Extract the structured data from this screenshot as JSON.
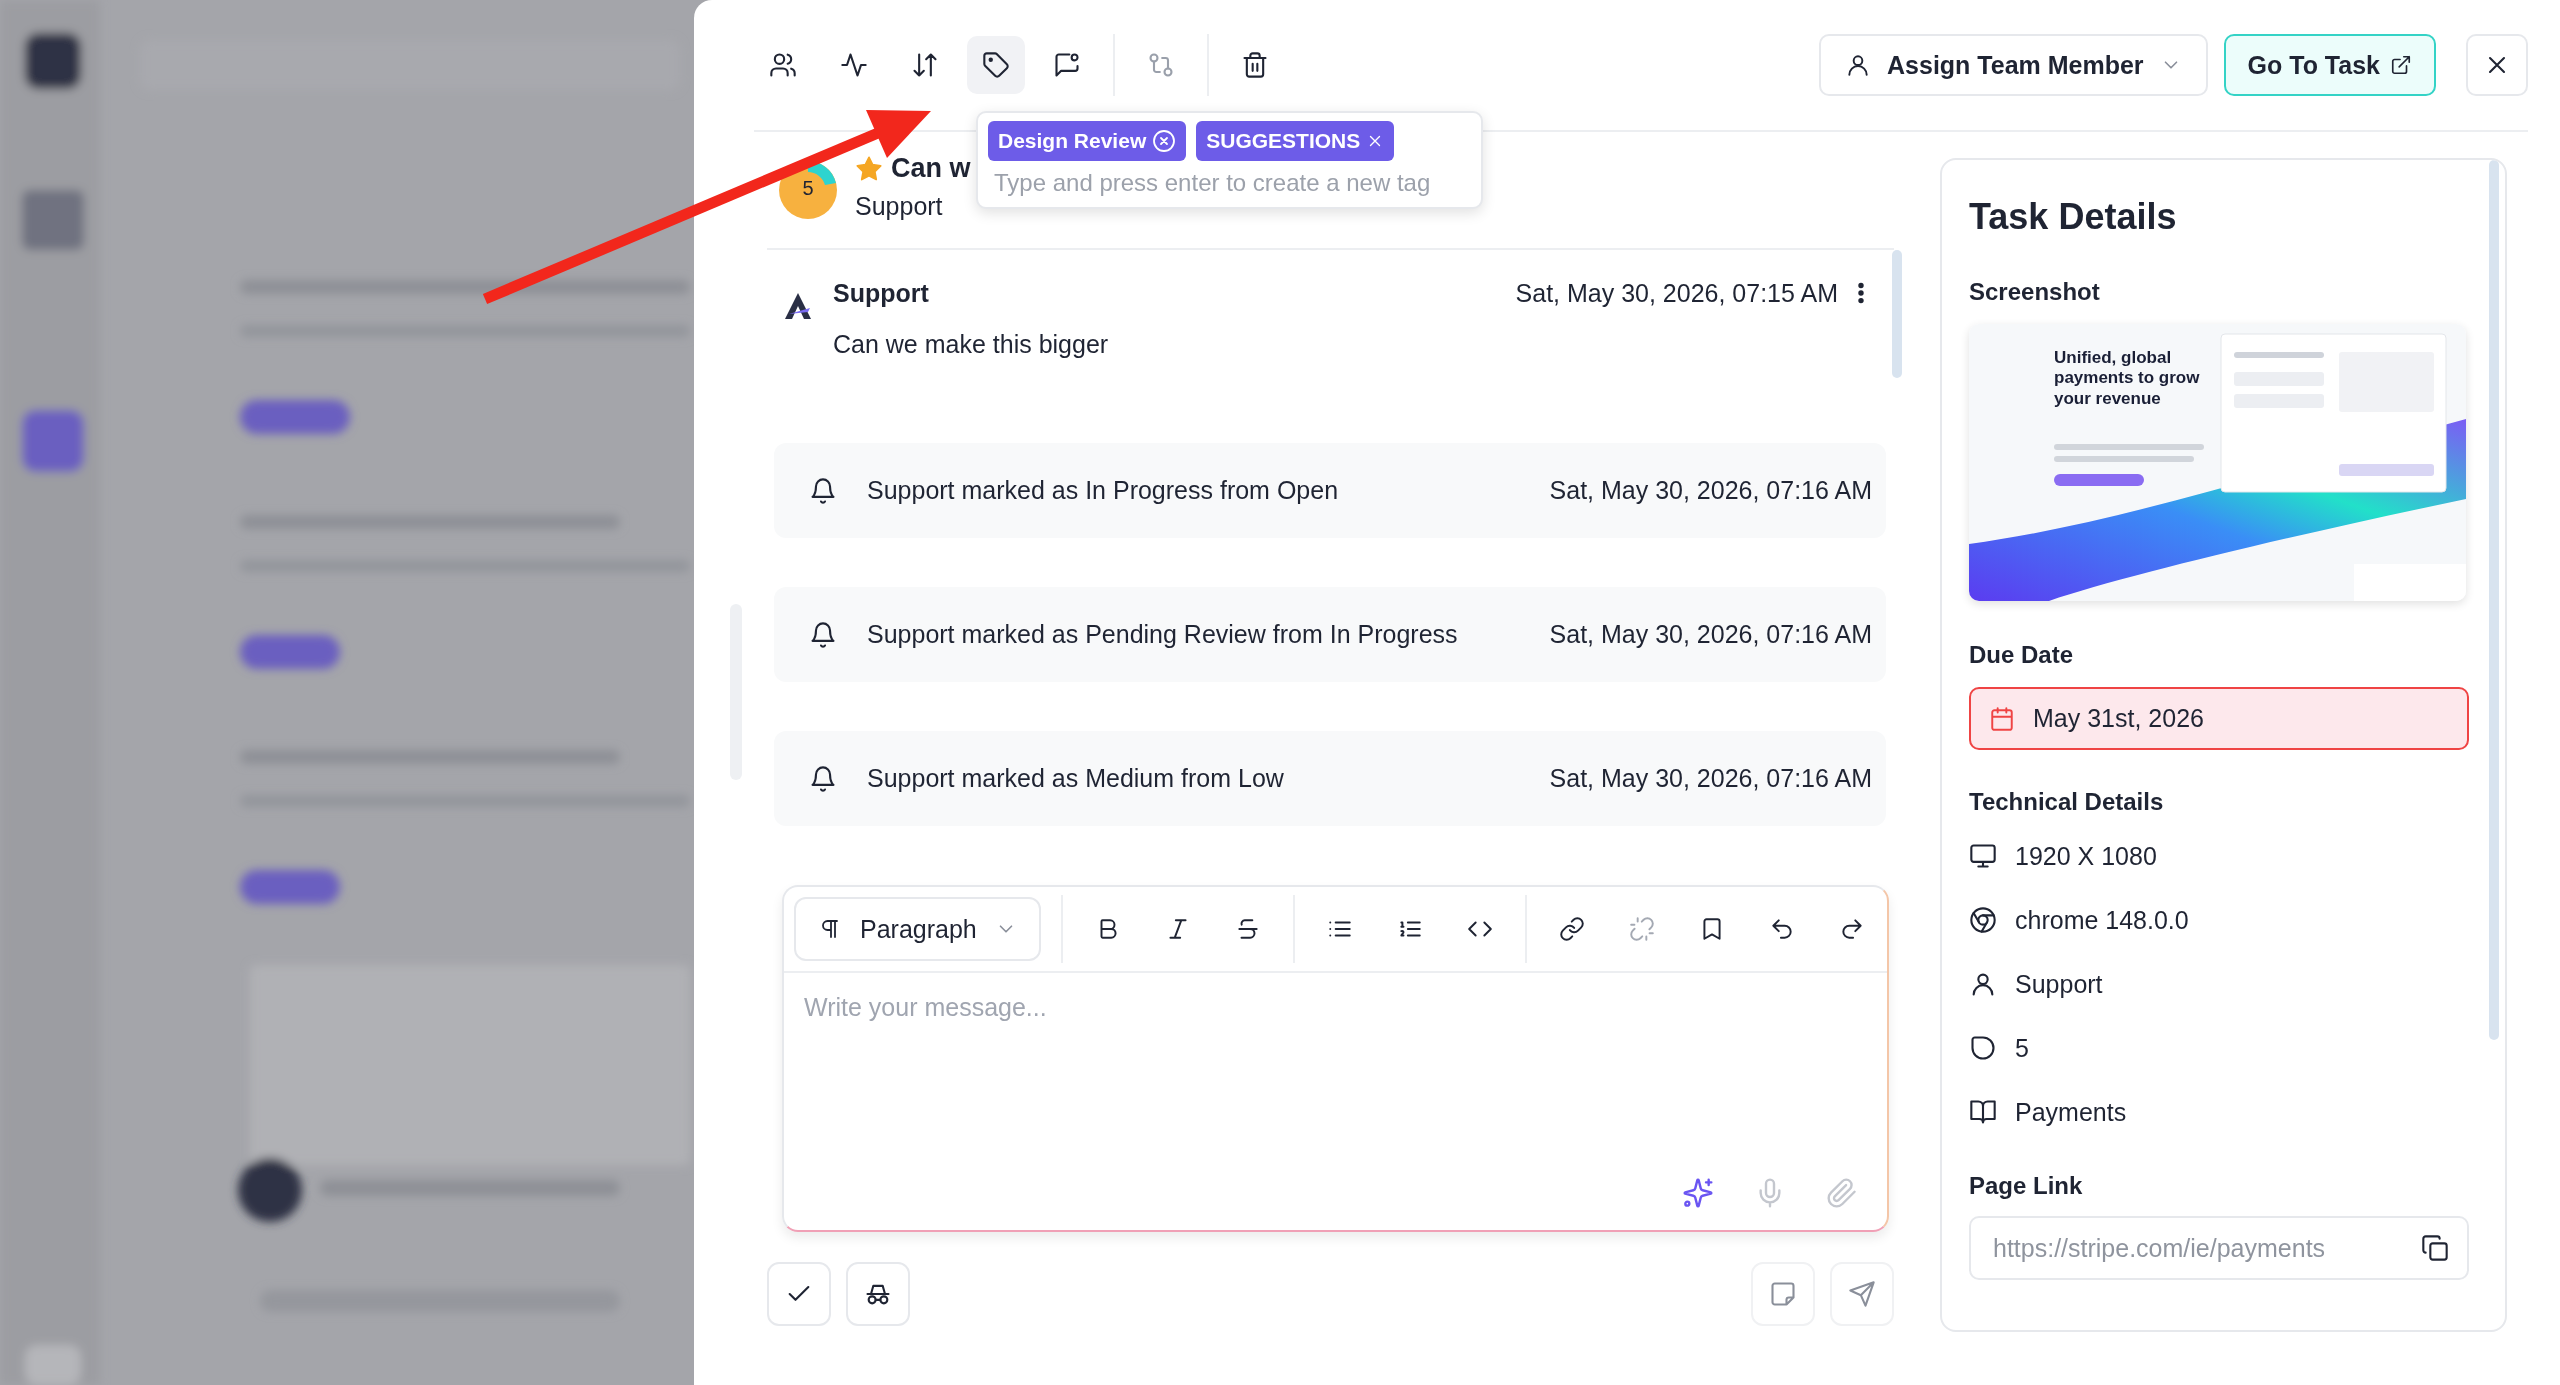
{
  "toolbar": {
    "tool_groups": [
      [
        {
          "kind": "users",
          "selected": false,
          "disabled": false
        },
        {
          "kind": "activity",
          "selected": false,
          "disabled": false
        },
        {
          "kind": "sort",
          "selected": false,
          "disabled": false
        },
        {
          "kind": "tag",
          "selected": true,
          "disabled": false
        },
        {
          "kind": "comment",
          "selected": false,
          "disabled": false
        }
      ],
      [
        {
          "kind": "compare",
          "selected": false,
          "disabled": true
        }
      ],
      [
        {
          "kind": "trash",
          "selected": false,
          "disabled": false
        }
      ]
    ],
    "assign_button": "Assign Team Member",
    "go_to_task_button": "Go To Task"
  },
  "tag_popover": {
    "tags": [
      {
        "label": "Design Review",
        "kind": "circled"
      },
      {
        "label": "SUGGESTIONS",
        "kind": "plain"
      }
    ],
    "placeholder": "Type and press enter to create a new tag"
  },
  "task": {
    "priority": "5",
    "starred": true,
    "title": "Can w",
    "author": "Support"
  },
  "comment": {
    "author": "Support",
    "time": "Sat, May 30, 2026, 07:15 AM",
    "text": "Can we make this bigger"
  },
  "activity": [
    {
      "text": "Support marked as In Progress from Open",
      "time": "Sat, May 30, 2026, 07:16 AM"
    },
    {
      "text": "Support marked as Pending Review from In Progress",
      "time": "Sat, May 30, 2026, 07:16 AM"
    },
    {
      "text": "Support marked as Medium from Low",
      "time": "Sat, May 30, 2026, 07:16 AM"
    }
  ],
  "editor": {
    "block_type": "Paragraph",
    "tool_groups": [
      [
        {
          "kind": "bold",
          "disabled": false
        },
        {
          "kind": "italic",
          "disabled": false
        },
        {
          "kind": "strike",
          "disabled": false
        }
      ],
      [
        {
          "kind": "bullets",
          "disabled": false
        },
        {
          "kind": "numbers",
          "disabled": false
        },
        {
          "kind": "code",
          "disabled": false
        }
      ],
      [
        {
          "kind": "link",
          "disabled": false
        },
        {
          "kind": "unlink",
          "disabled": true
        },
        {
          "kind": "bookmark",
          "disabled": false
        },
        {
          "kind": "undo",
          "disabled": false
        },
        {
          "kind": "redo",
          "disabled": false
        }
      ]
    ],
    "placeholder": "Write your message...",
    "composer_tools": [
      {
        "kind": "sparkles",
        "disabled": false
      },
      {
        "kind": "mic",
        "disabled": true
      },
      {
        "kind": "paperclip",
        "disabled": true
      }
    ]
  },
  "actions_left": [
    {
      "kind": "check",
      "disabled": false
    },
    {
      "kind": "incognito",
      "disabled": false
    }
  ],
  "actions_right": [
    {
      "kind": "note",
      "disabled": true
    },
    {
      "kind": "send",
      "disabled": true
    }
  ],
  "details": {
    "title": "Task Details",
    "screenshot_label": "Screenshot",
    "screenshot_headline": "Unified, global payments to grow your revenue",
    "due_date_label": "Due Date",
    "due_date": "May 31st, 2026",
    "overdue": true,
    "technical_label": "Technical Details",
    "technical": [
      {
        "kind": "monitor",
        "text": "1920 X 1080"
      },
      {
        "kind": "chrome",
        "text": "chrome 148.0.0"
      },
      {
        "kind": "user",
        "text": "Support"
      },
      {
        "kind": "shield",
        "text": "5"
      },
      {
        "kind": "book",
        "text": "Payments"
      }
    ],
    "page_link_label": "Page Link",
    "page_link": "https://stripe.com/ie/payments"
  }
}
